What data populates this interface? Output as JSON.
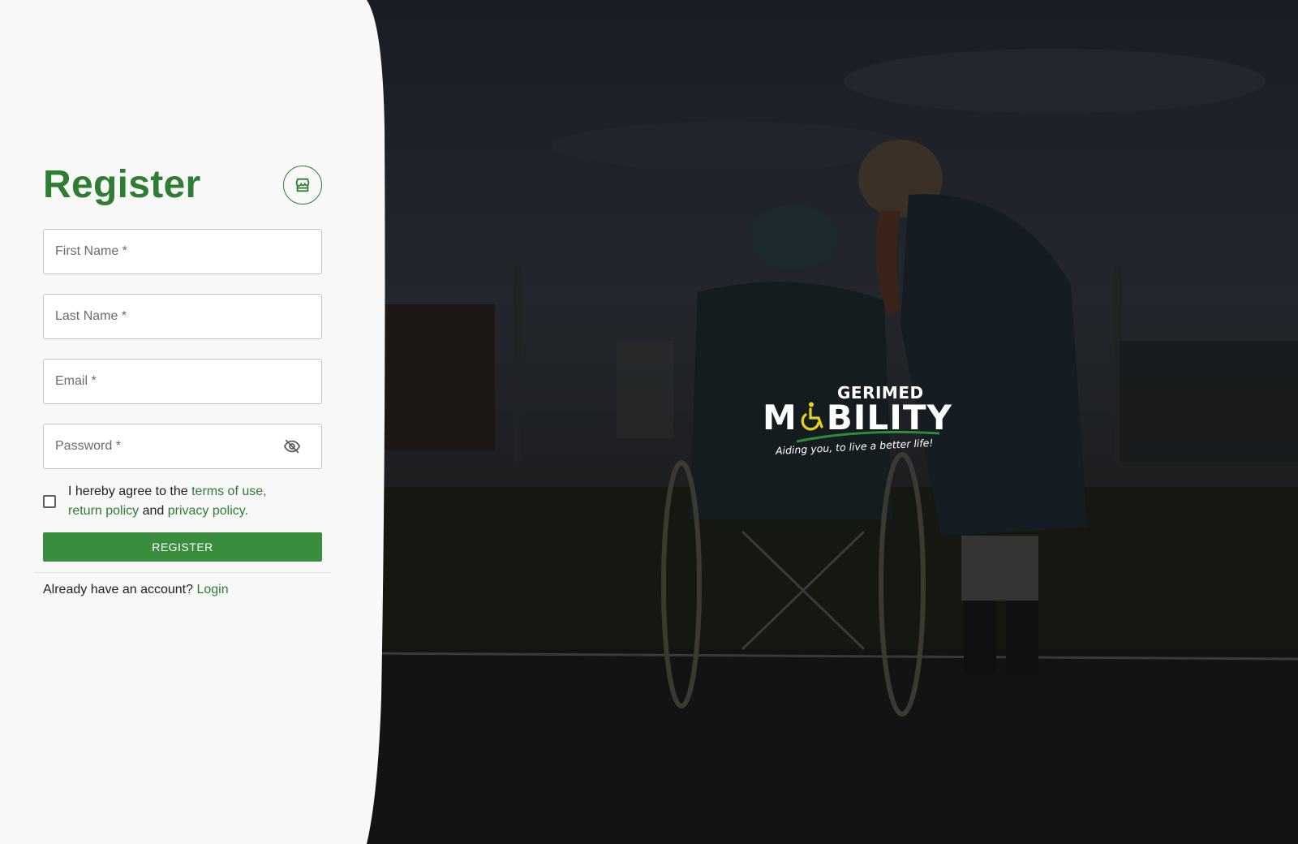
{
  "register": {
    "title": "Register",
    "shop_icon": "storefront-icon",
    "fields": {
      "first_name": {
        "placeholder": "First Name *",
        "value": ""
      },
      "last_name": {
        "placeholder": "Last Name *",
        "value": ""
      },
      "email": {
        "placeholder": "Email *",
        "value": ""
      },
      "password": {
        "placeholder": "Password *",
        "value": "",
        "toggle_icon": "eye-off-icon"
      }
    },
    "agreement": {
      "checked": false,
      "prefix": "I hereby agree to the ",
      "terms_link": "terms of use,",
      "return_link": "return policy",
      "and_text": " and ",
      "privacy_link": "privacy policy."
    },
    "submit_label": "REGISTER",
    "login_prompt": "Already have an account? ",
    "login_link": "Login"
  },
  "brand": {
    "top": "GERIMED",
    "main_before": "M",
    "main_after": "BILITY",
    "tagline": "Aiding you, to live a better life!",
    "wheelchair_icon": "wheelchair-icon"
  },
  "colors": {
    "accent_green": "#2e7d32",
    "button_green": "#388e3c",
    "logo_yellow": "#e6d21c",
    "panel_bg": "#f8f8f8"
  }
}
